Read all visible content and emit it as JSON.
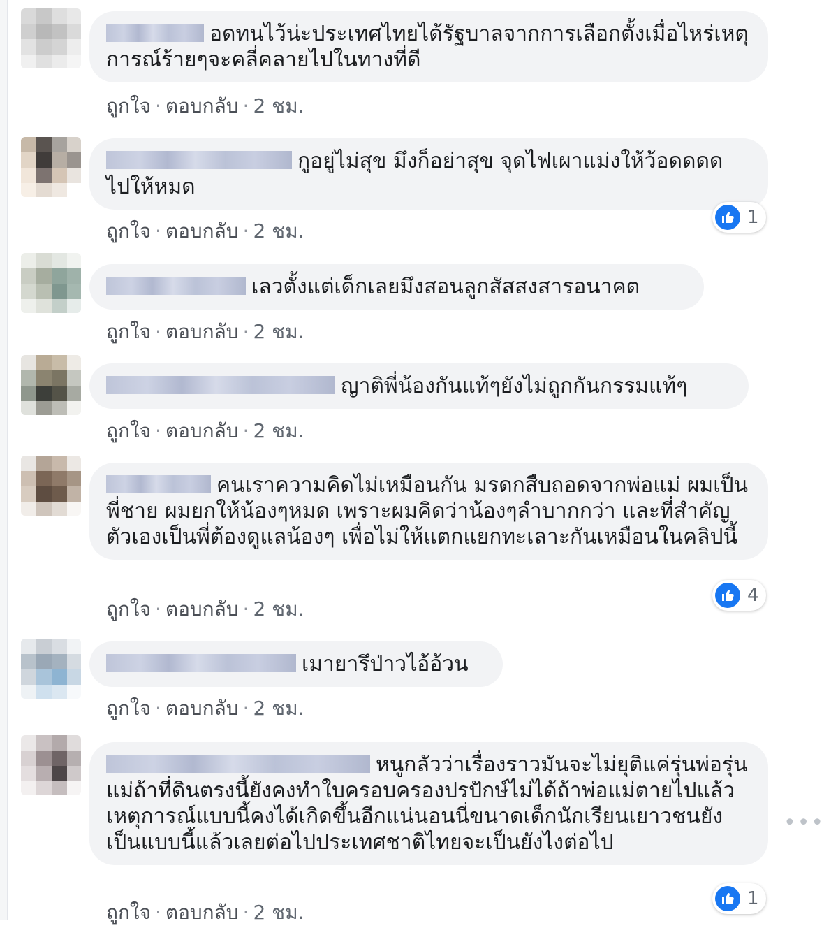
{
  "labels": {
    "like": "ถูกใจ",
    "reply": "ตอบกลับ",
    "time": "2 ชม.",
    "separator": "·"
  },
  "comments": [
    {
      "text": "อดทนไว้น่ะประเทศไทยได้รัฐบาลจากการเลือกตั้งเมื่อไหร่เหตุการณ์ร้ายๆจะคลี่คลายไปในทางที่ดี",
      "reactions": null
    },
    {
      "text": "กูอยู่ไม่สุข มึงก็อย่าสุข จุดไฟเผาแม่งให้ว้อดดดด ไปให้หมด",
      "reactions": "1"
    },
    {
      "text": "เลวตั้งแต่เด็กเลยมึงสอนลูกสัสสงสารอนาคต",
      "reactions": null
    },
    {
      "text": "ญาติพี่น้องกันแท้ๆยังไม่ถูกกันกรรมแท้ๆ",
      "reactions": null
    },
    {
      "text": "คนเราความคิดไม่เหมือนกัน มรดกสืบถอดจากพ่อแม่ ผมเป็นพี่ชาย ผมยกให้น้องๆหมด เพราะผมคิดว่าน้องๆลำบากกว่า และที่สำคัญตัวเองเป็นพี่ต้องดูแลน้องๆ เพื่อไม่ให้แตกแยกทะเลาะกันเหมือนในคลิปนี้",
      "reactions": "4"
    },
    {
      "text": "เมายารึป่าวไอ้อ้วน",
      "reactions": null
    },
    {
      "text": "หนูกลัวว่าเรื่องราวมันจะไม่ยุติแค่รุ่นพ่อรุ่นแม่ถ้าที่ดินตรงนี้ยังคงทำใบครอบครองปรปักษ์ไม่ได้ถ้าพ่อแม่ตายไปแล้วเหตุการณ์แบบนี้คงได้เกิดขึ้นอีกแน่นอนนี่ขนาดเด็กนักเรียนเยาวชนยังเป็นแบบนี้แล้วเลยต่อไปประเทศชาติไทยจะเป็นยังไงต่อไป",
      "reactions": "1"
    }
  ],
  "more_icon": "ellipsis-icon",
  "colors": {
    "bubble": "#f2f3f5",
    "like_blue": "#1877f2",
    "action_text": "#606770"
  }
}
